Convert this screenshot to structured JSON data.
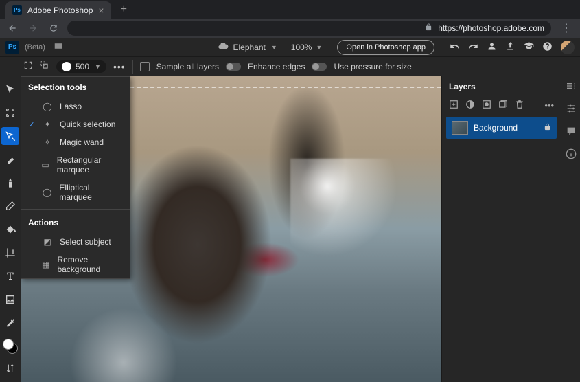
{
  "browser": {
    "tab_title": "Adobe Photoshop",
    "url": "https://photoshop.adobe.com"
  },
  "header": {
    "beta_label": "(Beta)",
    "doc_name": "Elephant",
    "zoom": "100%",
    "open_app_label": "Open in Photoshop app"
  },
  "options": {
    "brush_size": "500",
    "sample_all": "Sample all layers",
    "enhance": "Enhance edges",
    "pressure": "Use pressure for size"
  },
  "flyout": {
    "title": "Selection tools",
    "items": [
      "Lasso",
      "Quick selection",
      "Magic wand",
      "Rectangular marquee",
      "Elliptical marquee"
    ],
    "actions_title": "Actions",
    "actions": [
      "Select subject",
      "Remove background"
    ]
  },
  "layers": {
    "title": "Layers",
    "bg_label": "Background"
  }
}
